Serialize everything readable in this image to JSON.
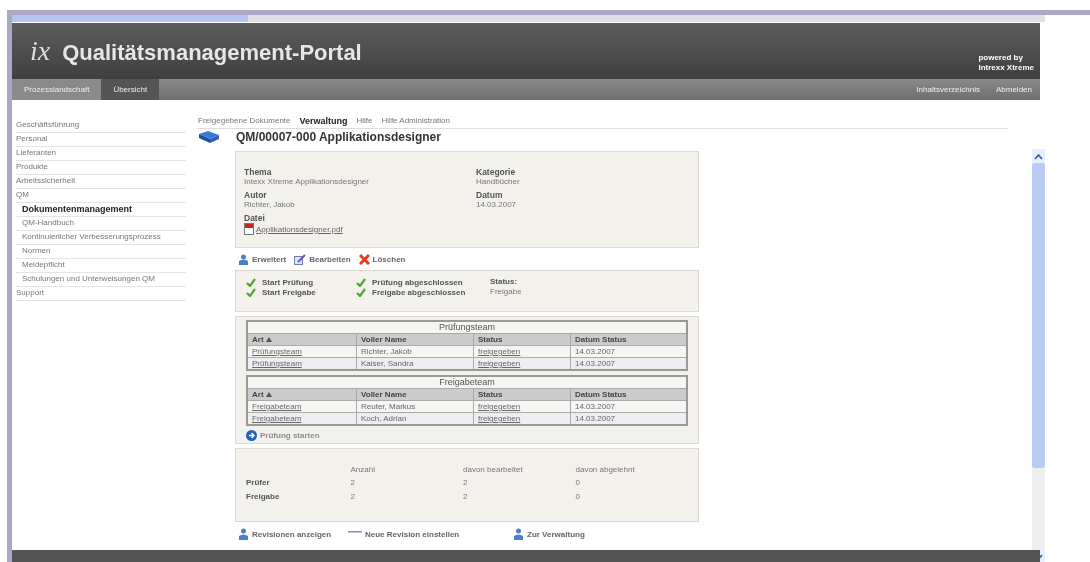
{
  "header": {
    "logo": "ix",
    "title": "Qualitätsmanagement-Portal",
    "powered_by": [
      "powered by",
      "Intrexx Xtreme"
    ]
  },
  "nav": {
    "items": [
      {
        "label": "Prozesslandschaft",
        "selected": false
      },
      {
        "label": "Übersicht",
        "selected": true
      }
    ],
    "right_links": [
      "Inhaltsverzeichnis",
      "Abmelden"
    ]
  },
  "sidebar": {
    "items": [
      {
        "label": "Geschäftsführung",
        "selected": false
      },
      {
        "label": "Personal",
        "selected": false
      },
      {
        "label": "Lieferanten",
        "selected": false
      },
      {
        "label": "Produkte",
        "selected": false
      },
      {
        "label": "Arbeitssicherheit",
        "selected": false
      },
      {
        "label": "QM",
        "selected": false,
        "children": [
          {
            "label": "Dokumentenmanagement",
            "selected": true
          },
          {
            "label": "QM-Handbuch",
            "selected": false
          },
          {
            "label": "Kontinuierlicher Verbesserungsprozess",
            "selected": false
          },
          {
            "label": "Normen",
            "selected": false
          },
          {
            "label": "Meldepflicht",
            "selected": false
          },
          {
            "label": "Schulungen und Unterweisungen QM",
            "selected": false
          }
        ]
      },
      {
        "label": "Support",
        "selected": false
      }
    ]
  },
  "tabs": [
    {
      "label": "Freigegebene Dokumente",
      "selected": false
    },
    {
      "label": "Verwaltung",
      "selected": true
    },
    {
      "label": "Hilfe",
      "selected": false
    },
    {
      "label": "Hilfe Administration",
      "selected": false
    }
  ],
  "document": {
    "title": "QM/00007-000 Applikationsdesigner",
    "fields": [
      {
        "label": "Thema",
        "value": "Intexx Xtreme Applikationsdesigner"
      },
      {
        "label": "Kategorie",
        "value": "Handbücher"
      },
      {
        "label": "Autor",
        "value": "Richter, Jakob"
      },
      {
        "label": "Datum",
        "value": "14.03.2007"
      }
    ],
    "file": {
      "label": "Datei",
      "name": "Applikationsdesigner.pdf"
    }
  },
  "actions": [
    {
      "kind": "extend",
      "label": "Erweitert"
    },
    {
      "kind": "edit",
      "label": "Bearbeiten"
    },
    {
      "kind": "delete",
      "label": "Löschen"
    }
  ],
  "steps": [
    {
      "label": "Start Prüfung",
      "checked": true
    },
    {
      "label": "Prüfung abgeschlossen",
      "checked": true
    },
    {
      "label": "Start Freigabe",
      "checked": true
    },
    {
      "label": "Freigabe abgeschlossen",
      "checked": true
    }
  ],
  "status": {
    "label": "Status:",
    "value": "Freigabe"
  },
  "teams": [
    {
      "title": "Prüfungsteam",
      "columns": [
        {
          "label": "Art",
          "sorted": true
        },
        {
          "label": "Voller Name",
          "sorted": false
        },
        {
          "label": "Status",
          "sorted": false
        },
        {
          "label": "Datum Status",
          "sorted": false
        }
      ],
      "rows": [
        [
          "Prüfungsteam",
          "Richter, Jakob",
          "freigegeben",
          "14.03.2007"
        ],
        [
          "Prüfungsteam",
          "Kaiser, Sandra",
          "freigegeben",
          "14.03.2007"
        ]
      ]
    },
    {
      "title": "Freigabeteam",
      "columns": [
        {
          "label": "Art",
          "sorted": true
        },
        {
          "label": "Voller Name",
          "sorted": false
        },
        {
          "label": "Status",
          "sorted": false
        },
        {
          "label": "Datum Status",
          "sorted": false
        }
      ],
      "rows": [
        [
          "Freigabeteam",
          "Reuter, Markus",
          "freigegeben",
          "14.03.2007"
        ],
        [
          "Freigabeteam",
          "Koch, Adrian",
          "freigegeben",
          "14.03.2007"
        ]
      ]
    }
  ],
  "start_review": {
    "label": "Prüfung starten",
    "disabled": true
  },
  "stats": {
    "columns": [
      "Anzahl",
      "davon bearbeitet",
      "davon abgelehnt"
    ],
    "rows": [
      {
        "label": "Prüfer",
        "values": [
          "2",
          "2",
          "0"
        ]
      },
      {
        "label": "Freigabe",
        "values": [
          "2",
          "2",
          "0"
        ]
      }
    ]
  },
  "footer_links": [
    {
      "kind": "user",
      "label": "Revisionen anzeigen"
    },
    {
      "kind": "plain",
      "label": "Neue Revision einstellen"
    },
    {
      "kind": "user",
      "label": "Zur Verwaltung"
    }
  ]
}
